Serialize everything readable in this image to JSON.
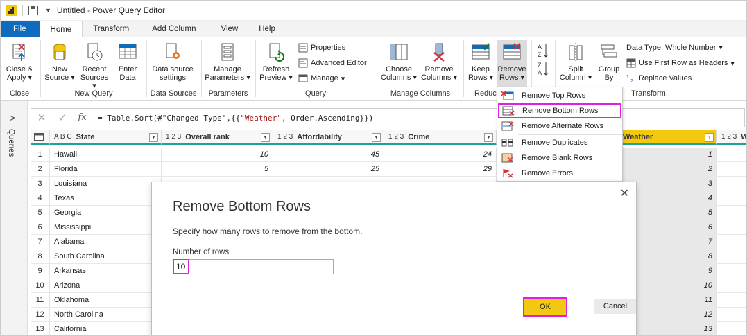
{
  "window": {
    "title": "Untitled - Power Query Editor"
  },
  "tabs": [
    {
      "label": "File"
    },
    {
      "label": "Home"
    },
    {
      "label": "Transform"
    },
    {
      "label": "Add Column"
    },
    {
      "label": "View"
    },
    {
      "label": "Help"
    }
  ],
  "ribbon": {
    "close_apply": [
      "Close &",
      "Apply"
    ],
    "new_source": [
      "New",
      "Source"
    ],
    "recent_sources": [
      "Recent",
      "Sources"
    ],
    "enter_data": [
      "Enter",
      "Data"
    ],
    "data_source_settings": [
      "Data source",
      "settings"
    ],
    "manage_parameters": [
      "Manage",
      "Parameters"
    ],
    "refresh_preview": [
      "Refresh",
      "Preview"
    ],
    "properties": "Properties",
    "advanced_editor": "Advanced Editor",
    "manage": "Manage",
    "choose_columns": [
      "Choose",
      "Columns"
    ],
    "remove_columns": [
      "Remove",
      "Columns"
    ],
    "keep_rows": [
      "Keep",
      "Rows"
    ],
    "remove_rows": [
      "Remove",
      "Rows"
    ],
    "split_column": [
      "Split",
      "Column"
    ],
    "group_by": [
      "Group",
      "By"
    ],
    "data_type": "Data Type: Whole Number",
    "first_row_headers": "Use First Row as Headers",
    "replace_values": "Replace Values",
    "groups": {
      "close": "Close",
      "new_query": "New Query",
      "data_sources": "Data Sources",
      "parameters": "Parameters",
      "query": "Query",
      "manage_columns": "Manage Columns",
      "reduce": "Reduc",
      "transform": "Transform"
    }
  },
  "left_pane": {
    "label": "Queries"
  },
  "formula": {
    "prefix": "= Table.Sort(#\"Changed Type\",{{",
    "string": "\"Weather\"",
    "suffix": ", Order.Ascending}})"
  },
  "grid": {
    "columns": [
      {
        "type": "A B C",
        "name": "State"
      },
      {
        "type": "1 2 3",
        "name": "Overall rank"
      },
      {
        "type": "1 2 3",
        "name": "Affordability"
      },
      {
        "type": "1 2 3",
        "name": "Crime"
      },
      {
        "type": "",
        "name": "Weather"
      },
      {
        "type": "1 2 3",
        "name": "We"
      }
    ],
    "rows": [
      {
        "idx": "1",
        "state": "Hawaii",
        "rank": "10",
        "afford": "45",
        "crime": "24",
        "weather": "1"
      },
      {
        "idx": "2",
        "state": "Florida",
        "rank": "5",
        "afford": "25",
        "crime": "29",
        "weather": "2"
      },
      {
        "idx": "3",
        "state": "Louisiana",
        "rank": "",
        "afford": "",
        "crime": "",
        "weather": "3"
      },
      {
        "idx": "4",
        "state": "Texas",
        "rank": "",
        "afford": "",
        "crime": "",
        "weather": "4"
      },
      {
        "idx": "5",
        "state": "Georgia",
        "rank": "",
        "afford": "",
        "crime": "",
        "weather": "5"
      },
      {
        "idx": "6",
        "state": "Mississippi",
        "rank": "",
        "afford": "",
        "crime": "",
        "weather": "6"
      },
      {
        "idx": "7",
        "state": "Alabama",
        "rank": "",
        "afford": "",
        "crime": "",
        "weather": "7"
      },
      {
        "idx": "8",
        "state": "South Carolina",
        "rank": "",
        "afford": "",
        "crime": "",
        "weather": "8"
      },
      {
        "idx": "9",
        "state": "Arkansas",
        "rank": "",
        "afford": "",
        "crime": "",
        "weather": "9"
      },
      {
        "idx": "10",
        "state": "Arizona",
        "rank": "",
        "afford": "",
        "crime": "",
        "weather": "10"
      },
      {
        "idx": "11",
        "state": "Oklahoma",
        "rank": "",
        "afford": "",
        "crime": "",
        "weather": "11"
      },
      {
        "idx": "12",
        "state": "North Carolina",
        "rank": "",
        "afford": "",
        "crime": "",
        "weather": "12"
      },
      {
        "idx": "13",
        "state": "California",
        "rank": "",
        "afford": "",
        "crime": "",
        "weather": "13"
      }
    ]
  },
  "dropdown": {
    "items": [
      {
        "label": "Remove Top Rows"
      },
      {
        "label": "Remove Bottom Rows"
      },
      {
        "label": "Remove Alternate Rows"
      },
      {
        "label": "Remove Duplicates"
      },
      {
        "label": "Remove Blank Rows"
      },
      {
        "label": "Remove Errors"
      }
    ]
  },
  "dialog": {
    "title": "Remove Bottom Rows",
    "description": "Specify how many rows to remove from the bottom.",
    "field_label": "Number of rows",
    "field_value": "10",
    "ok_label": "OK",
    "cancel_label": "Cancel",
    "close_glyph": "✕"
  },
  "colors": {
    "accent_yellow": "#f2c811",
    "highlight_magenta": "#e020e0",
    "file_tab_blue": "#0f6cbd",
    "header_teal": "#1fa09c"
  }
}
